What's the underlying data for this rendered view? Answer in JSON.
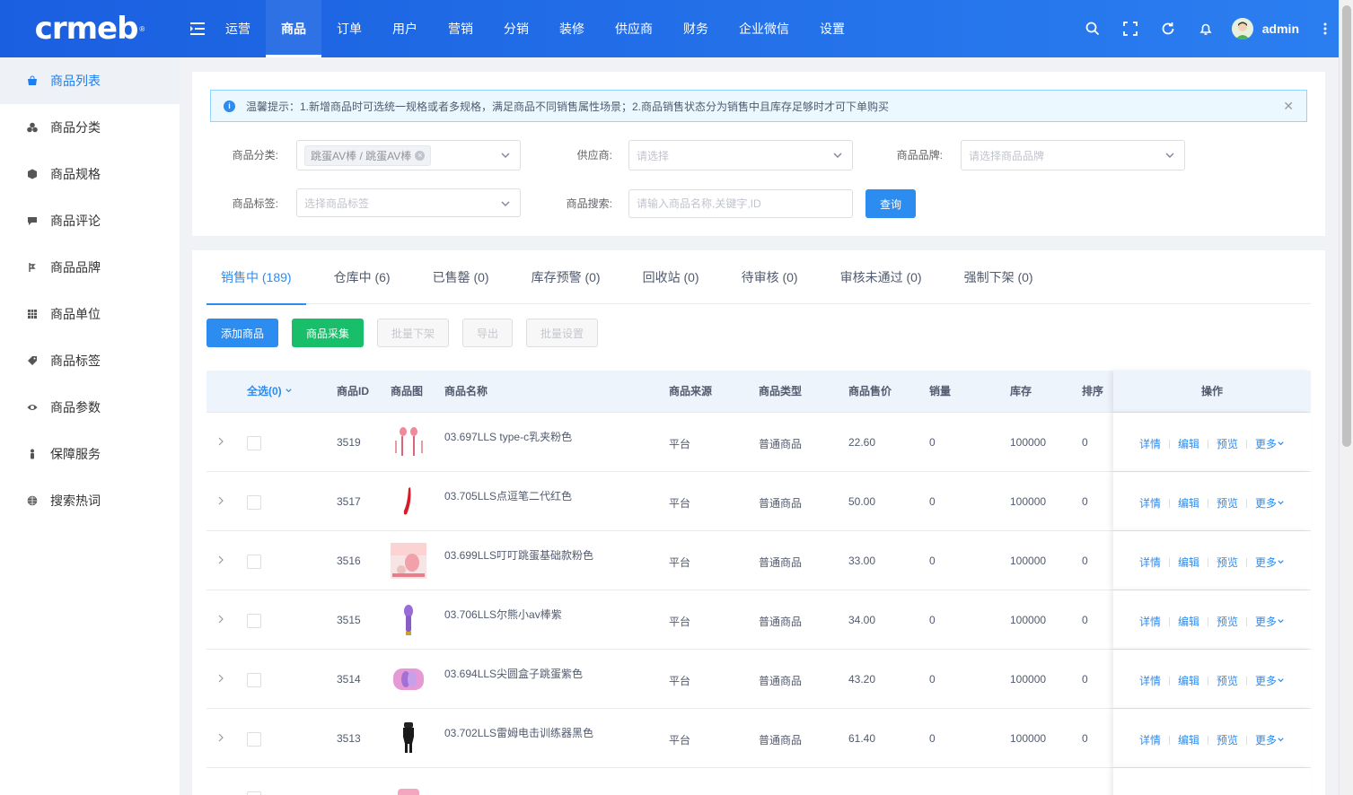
{
  "brand": {
    "logo_text": "crmeb",
    "reg_mark": "®"
  },
  "topnav": [
    "运营",
    "商品",
    "订单",
    "用户",
    "营销",
    "分销",
    "装修",
    "供应商",
    "财务",
    "企业微信",
    "设置"
  ],
  "topnav_active": 1,
  "user": {
    "name": "admin"
  },
  "sidebar": [
    {
      "label": "商品列表",
      "icon": "shop-bag-icon"
    },
    {
      "label": "商品分类",
      "icon": "cluster-icon"
    },
    {
      "label": "商品规格",
      "icon": "cube-icon"
    },
    {
      "label": "商品评论",
      "icon": "comment-icon"
    },
    {
      "label": "商品品牌",
      "icon": "brand-icon"
    },
    {
      "label": "商品单位",
      "icon": "grid-icon"
    },
    {
      "label": "商品标签",
      "icon": "tag-icon"
    },
    {
      "label": "商品参数",
      "icon": "eye-icon"
    },
    {
      "label": "保障服务",
      "icon": "service-icon"
    },
    {
      "label": "搜索热词",
      "icon": "globe-icon"
    }
  ],
  "alert": {
    "text": "温馨提示：1.新增商品时可选统一规格或者多规格，满足商品不同销售属性场景；2.商品销售状态分为销售中且库存足够时才可下单购买"
  },
  "filters": {
    "category_label": "商品分类:",
    "category_tag": "跳蛋AV棒 / 跳蛋AV棒",
    "supplier_label": "供应商:",
    "supplier_placeholder": "请选择",
    "brand_label": "商品品牌:",
    "brand_placeholder": "请选择商品品牌",
    "tag_label": "商品标签:",
    "tag_placeholder": "选择商品标签",
    "search_label": "商品搜索:",
    "search_placeholder": "请输入商品名称,关键字,ID",
    "query_button": "查询"
  },
  "tabs": [
    "销售中 (189)",
    "仓库中 (6)",
    "已售罄 (0)",
    "库存预警 (0)",
    "回收站 (0)",
    "待审核 (0)",
    "审核未通过 (0)",
    "强制下架 (0)"
  ],
  "tabs_active": 0,
  "actions": {
    "add": "添加商品",
    "collect": "商品采集",
    "batch_off": "批量下架",
    "export": "导出",
    "batch_set": "批量设置"
  },
  "table": {
    "select_all": "全选(0)",
    "headers": {
      "id": "商品ID",
      "image": "商品图",
      "name": "商品名称",
      "source": "商品来源",
      "type": "商品类型",
      "price": "商品售价",
      "sales": "销量",
      "stock": "库存",
      "sort": "排序",
      "ops": "操作"
    },
    "ops": {
      "detail": "详情",
      "edit": "编辑",
      "preview": "预览",
      "more": "更多"
    },
    "rows": [
      {
        "id": "3519",
        "name": "03.697LLS type-c乳夹粉色",
        "source": "平台",
        "type": "普通商品",
        "price": "22.60",
        "sales": "0",
        "stock": "100000",
        "sort": "0"
      },
      {
        "id": "3517",
        "name": "03.705LLS点逗笔二代红色",
        "source": "平台",
        "type": "普通商品",
        "price": "50.00",
        "sales": "0",
        "stock": "100000",
        "sort": "0"
      },
      {
        "id": "3516",
        "name": "03.699LLS叮叮跳蛋基础款粉色",
        "source": "平台",
        "type": "普通商品",
        "price": "33.00",
        "sales": "0",
        "stock": "100000",
        "sort": "0"
      },
      {
        "id": "3515",
        "name": "03.706LLS尔熊小av棒紫",
        "source": "平台",
        "type": "普通商品",
        "price": "34.00",
        "sales": "0",
        "stock": "100000",
        "sort": "0"
      },
      {
        "id": "3514",
        "name": "03.694LLS尖圆盒子跳蛋紫色",
        "source": "平台",
        "type": "普通商品",
        "price": "43.20",
        "sales": "0",
        "stock": "100000",
        "sort": "0"
      },
      {
        "id": "3513",
        "name": "03.702LLS雷姆电击训练器黑色",
        "source": "平台",
        "type": "普通商品",
        "price": "61.40",
        "sales": "0",
        "stock": "100000",
        "sort": "0"
      }
    ]
  },
  "colors": {
    "primary": "#2d8cf0",
    "success": "#19be6b",
    "header": "#1f6fe8"
  }
}
